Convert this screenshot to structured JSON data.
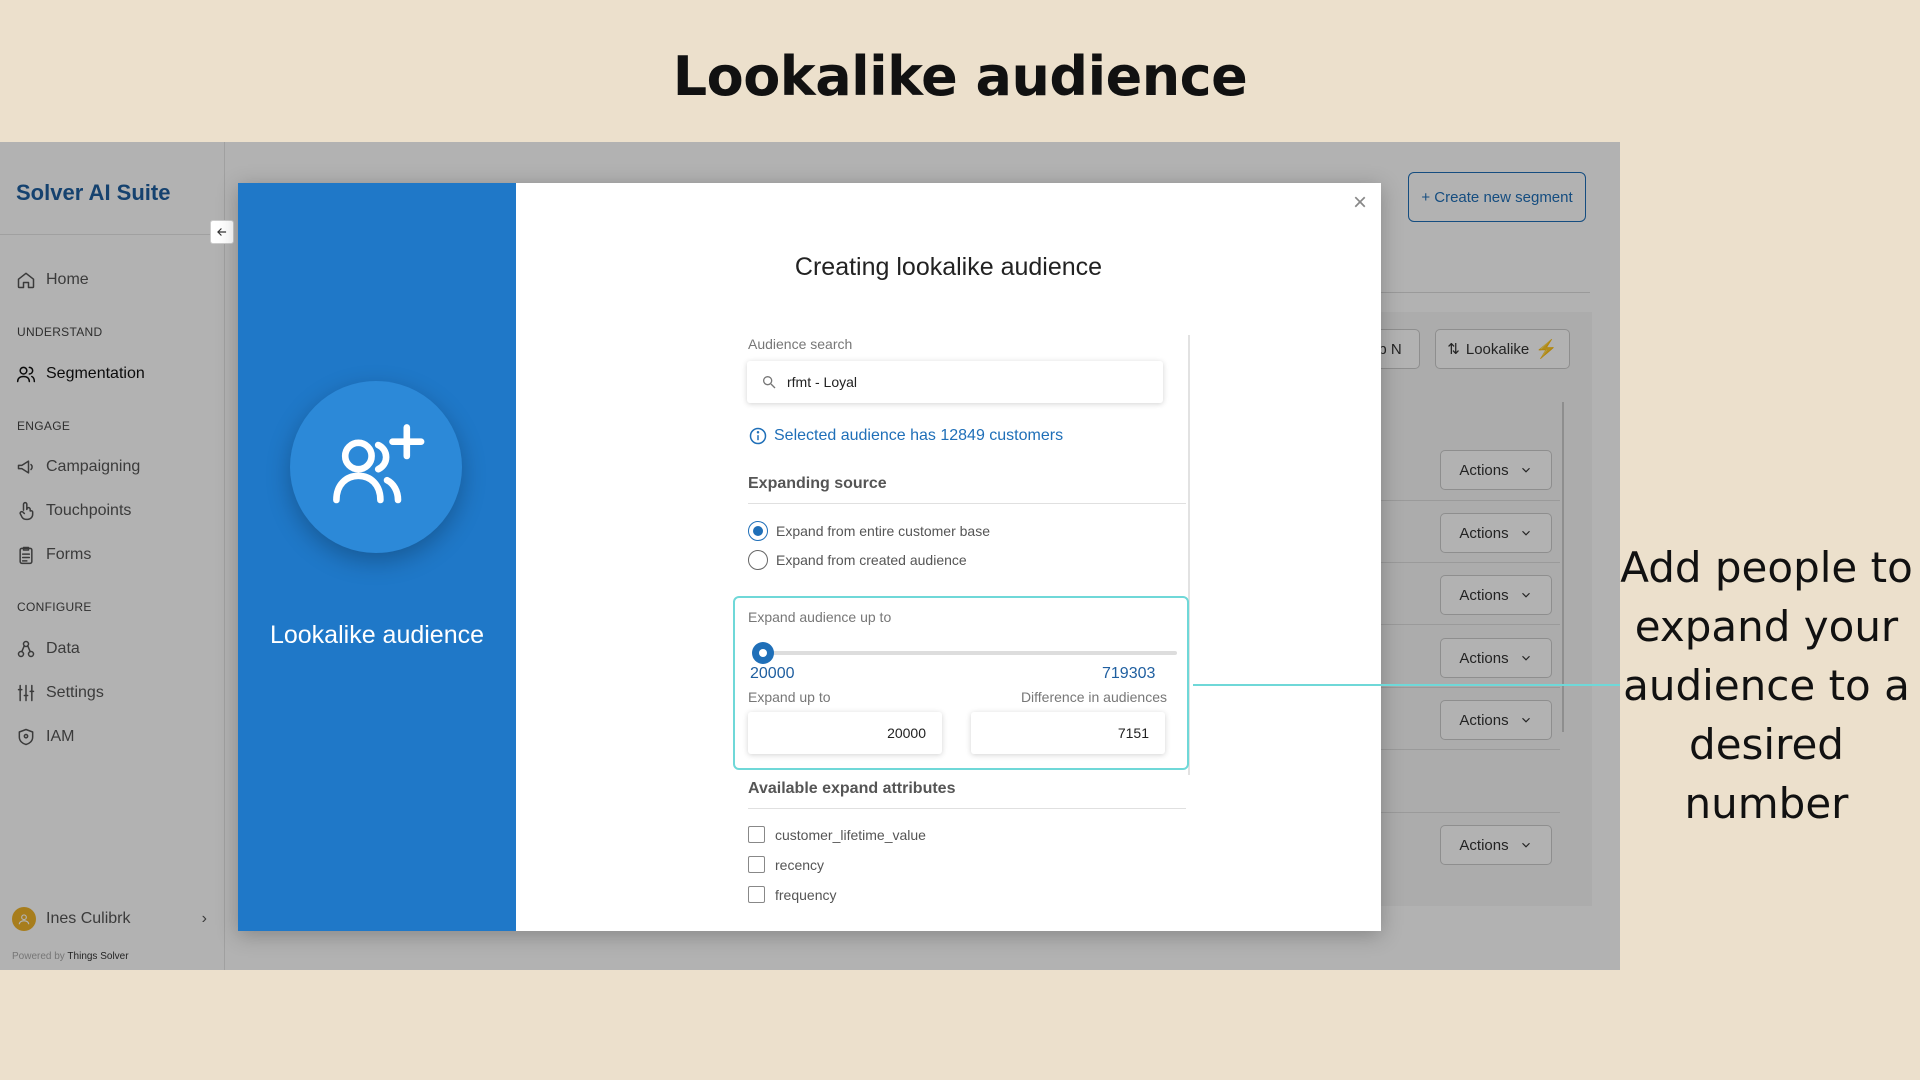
{
  "slide": {
    "title": "Lookalike audience",
    "annotation": "Add people to expand your audience to a desired number"
  },
  "sidebar": {
    "brand": "Solver AI Suite",
    "home": "Home",
    "section_understand": "UNDERSTAND",
    "segmentation": "Segmentation",
    "section_engage": "ENGAGE",
    "campaigning": "Campaigning",
    "touchpoints": "Touchpoints",
    "forms": "Forms",
    "section_configure": "CONFIGURE",
    "data": "Data",
    "settings": "Settings",
    "iam": "IAM",
    "user_name": "Ines Culibrk",
    "powered_by": "Powered by",
    "powered_company": "Things Solver"
  },
  "page": {
    "create_segment": "+ Create new segment",
    "partial_pill": "p N",
    "lookalike_pill": "Lookalike",
    "actions": [
      "Actions",
      "Actions",
      "Actions",
      "Actions",
      "Actions",
      "Actions"
    ]
  },
  "modal": {
    "left_title": "Lookalike audience",
    "title": "Creating lookalike audience",
    "audience_search_label": "Audience search",
    "audience_search_value": "rfmt - Loyal",
    "info_text": "Selected audience has 12849 customers",
    "expanding_source_heading": "Expanding source",
    "radio_options": [
      {
        "label": "Expand from entire customer base",
        "selected": true
      },
      {
        "label": "Expand from created audience",
        "selected": false
      }
    ],
    "expand_label": "Expand audience up to",
    "slider": {
      "min": 20000,
      "max": 719303,
      "value": 20000
    },
    "slider_min_label": "20000",
    "slider_max_label": "719303",
    "expand_up_to_label": "Expand up to",
    "difference_label": "Difference in audiences",
    "expand_up_to_value": "20000",
    "difference_value": "7151",
    "attributes_heading": "Available expand attributes",
    "attributes": [
      "customer_lifetime_value",
      "recency",
      "frequency"
    ]
  },
  "colors": {
    "primary": "#1f78c8",
    "brand_text": "#1f5fa0",
    "highlight": "#6fd8d8",
    "background": "#ece0cc"
  }
}
